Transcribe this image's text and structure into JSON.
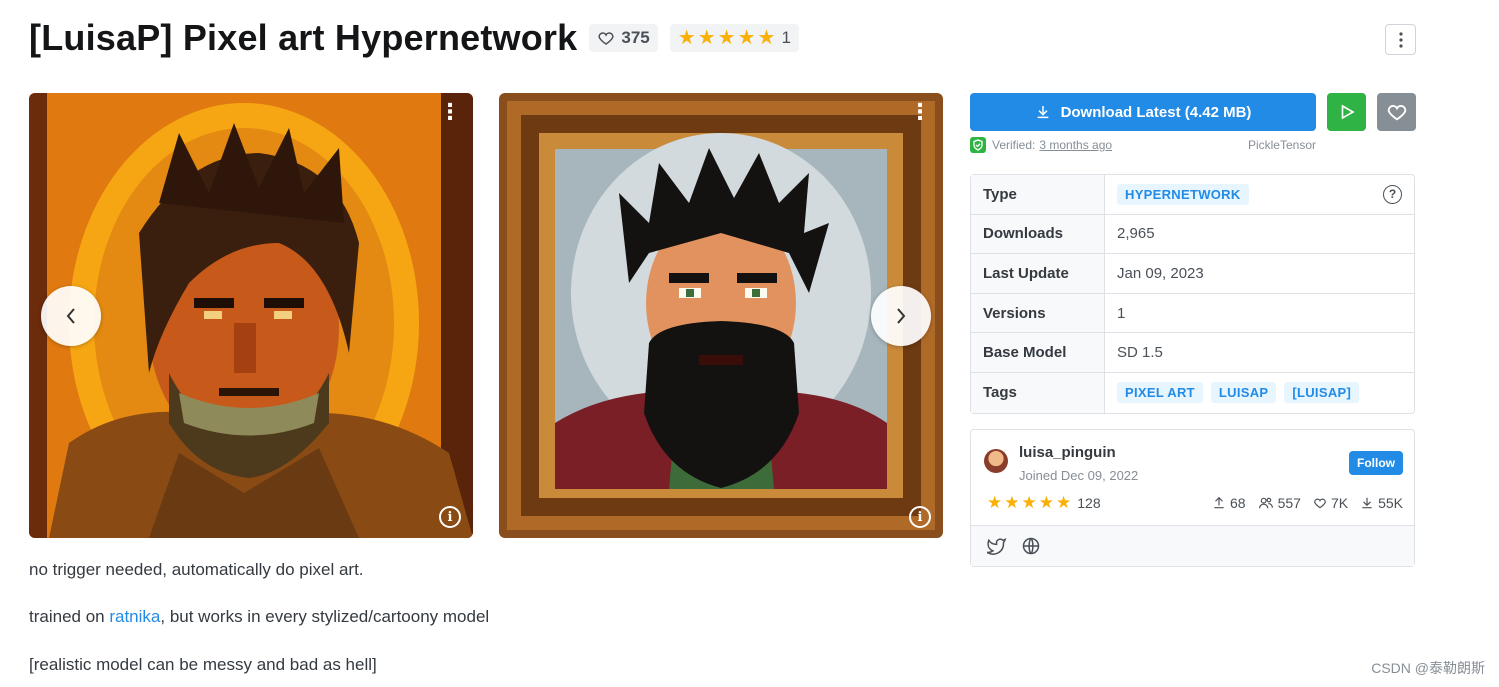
{
  "title": "[LuisaP] Pixel art Hypernetwork",
  "likes": "375",
  "rating": {
    "stars": 5,
    "count": "1"
  },
  "download": {
    "label": "Download Latest (4.42 MB)"
  },
  "verified": {
    "label": "Verified:",
    "date": "3 months ago",
    "uploader": "PickleTensor"
  },
  "details": [
    {
      "label": "Type",
      "badges": [
        "HYPERNETWORK"
      ]
    },
    {
      "label": "Downloads",
      "value": "2,965"
    },
    {
      "label": "Last Update",
      "value": "Jan 09, 2023"
    },
    {
      "label": "Versions",
      "value": "1"
    },
    {
      "label": "Base Model",
      "value": "SD 1.5"
    },
    {
      "label": "Tags",
      "badges": [
        "PIXEL ART",
        "LUISAP",
        "[LUISAP]"
      ]
    }
  ],
  "creator": {
    "name": "luisa_pinguin",
    "joined": "Joined Dec 09, 2022",
    "follow_label": "Follow",
    "rating_count": "128",
    "uploads": "68",
    "followers": "557",
    "favorites": "7K",
    "downloads": "55K"
  },
  "description": {
    "line1": "no trigger needed, automatically do pixel art.",
    "line2_prefix": "trained on ",
    "line2_link": "ratnika",
    "line2_suffix": ", but works in every stylized/cartoony model",
    "line3": "[realistic model can be messy and bad as hell]"
  },
  "watermark": "CSDN @泰勒朗斯",
  "colors": {
    "primary": "#228be6",
    "success": "#2fb344",
    "star": "#fab005",
    "muted": "#868e96"
  },
  "icons": [
    "heart-icon",
    "star-icon",
    "more-vertical-icon",
    "download-icon",
    "play-icon",
    "shield-check-icon",
    "help-circle-icon",
    "info-icon",
    "chevron-left-icon",
    "chevron-right-icon",
    "upload-icon",
    "users-icon",
    "twitter-icon",
    "globe-icon"
  ]
}
